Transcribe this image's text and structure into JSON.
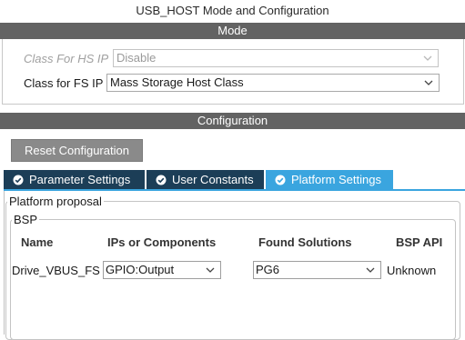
{
  "window": {
    "title": "USB_HOST Mode and Configuration"
  },
  "mode": {
    "header": "Mode",
    "hs_label": "Class For HS IP",
    "hs_value": "Disable",
    "fs_label": "Class for FS IP",
    "fs_value": "Mass Storage Host Class"
  },
  "configuration": {
    "header": "Configuration",
    "reset_label": "Reset Configuration",
    "tabs": [
      {
        "label": "Parameter Settings",
        "active": false
      },
      {
        "label": "User Constants",
        "active": false
      },
      {
        "label": "Platform Settings",
        "active": true
      }
    ]
  },
  "platform": {
    "legend": "Platform proposal",
    "bsp_legend": "BSP",
    "columns": [
      "Name",
      "IPs or Components",
      "Found Solutions",
      "BSP API"
    ],
    "rows": [
      {
        "name": "Drive_VBUS_FS",
        "component": "GPIO:Output",
        "solution": "PG6",
        "bsp_api": "Unknown"
      }
    ]
  },
  "colors": {
    "section_bar": "#636363",
    "tab_inactive": "#1c3e57",
    "tab_active": "#3aa5df",
    "reset_button": "#8a8a8a"
  },
  "icons": [
    "chevron-down-icon",
    "check-circle-icon"
  ]
}
